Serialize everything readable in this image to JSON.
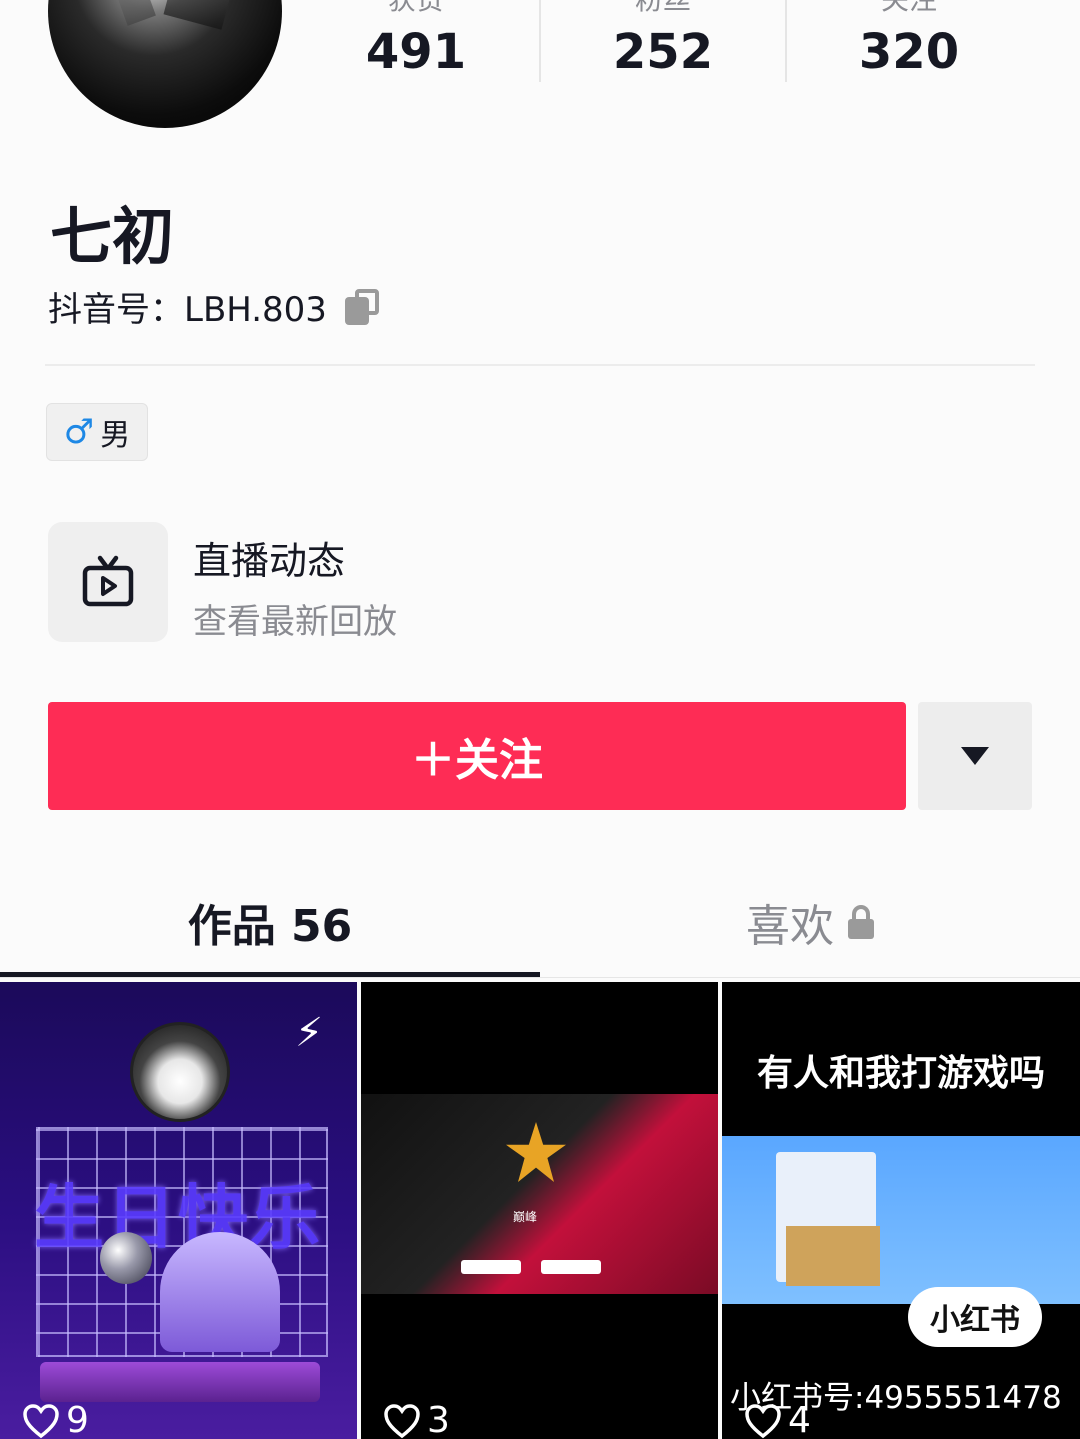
{
  "profile": {
    "nickname": "七初",
    "account_label": "抖音号：LBH.803",
    "gender_symbol": "♂",
    "gender": "男"
  },
  "stats": [
    {
      "label": "获赞",
      "value": "491"
    },
    {
      "label": "粉丝",
      "value": "252"
    },
    {
      "label": "关注",
      "value": "320"
    }
  ],
  "live": {
    "title": "直播动态",
    "subtitle": "查看最新回放"
  },
  "actions": {
    "follow_label": "＋关注"
  },
  "tabs": {
    "works": "作品 56",
    "likes": "喜欢"
  },
  "videos": [
    {
      "likes": "9",
      "overlay_text": "生日快乐"
    },
    {
      "likes": "3",
      "overlay_text": "巅峰"
    },
    {
      "likes": "4",
      "title": "有人和我打游戏吗",
      "badge": "小红书",
      "watermark": "小红书号:4955551478"
    }
  ],
  "colors": {
    "accent": "#fe2c55",
    "text_primary": "#161823",
    "text_secondary": "#8a8b91"
  }
}
